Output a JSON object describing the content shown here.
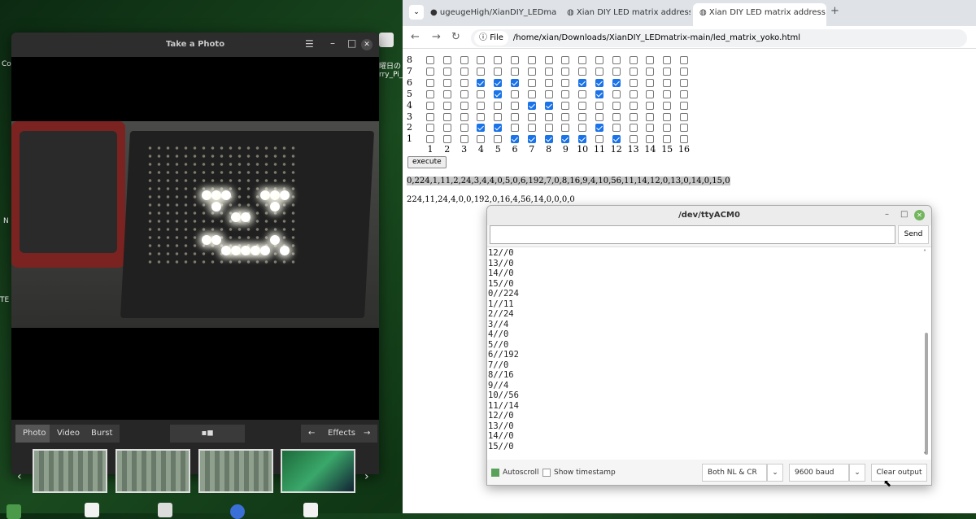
{
  "desktop": {
    "labels": [
      "Co",
      "N",
      "TE",
      "曜日の",
      "rry_Pi_"
    ]
  },
  "camera": {
    "title": "Take a Photo",
    "modes": [
      "Photo",
      "Video",
      "Burst"
    ],
    "effects_label": "Effects"
  },
  "browser": {
    "tabs": [
      {
        "title": "ugeugeHigh/XianDIY_LEDma"
      },
      {
        "title": "Xian DIY LED matrix address"
      },
      {
        "title": "Xian DIY LED matrix address"
      }
    ],
    "url_scheme": "File",
    "url": "/home/xian/Downloads/XianDIY_LEDmatrix-main/led_matrix_yoko.html"
  },
  "matrix": {
    "row_labels": [
      "8",
      "7",
      "6",
      "5",
      "4",
      "3",
      "2",
      "1"
    ],
    "col_labels": [
      "1",
      "2",
      "3",
      "4",
      "5",
      "6",
      "7",
      "8",
      "9",
      "10",
      "11",
      "12",
      "13",
      "14",
      "15",
      "16"
    ],
    "rows": [
      [
        0,
        0,
        0,
        0,
        0,
        0,
        0,
        0,
        0,
        0,
        0,
        0,
        0,
        0,
        0,
        0
      ],
      [
        0,
        0,
        0,
        0,
        0,
        0,
        0,
        0,
        0,
        0,
        0,
        0,
        0,
        0,
        0,
        0
      ],
      [
        0,
        0,
        0,
        1,
        1,
        1,
        0,
        0,
        0,
        1,
        1,
        1,
        0,
        0,
        0,
        0
      ],
      [
        0,
        0,
        0,
        0,
        1,
        0,
        0,
        0,
        0,
        0,
        1,
        0,
        0,
        0,
        0,
        0
      ],
      [
        0,
        0,
        0,
        0,
        0,
        0,
        1,
        1,
        0,
        0,
        0,
        0,
        0,
        0,
        0,
        0
      ],
      [
        0,
        0,
        0,
        0,
        0,
        0,
        0,
        0,
        0,
        0,
        0,
        0,
        0,
        0,
        0,
        0
      ],
      [
        0,
        0,
        0,
        1,
        1,
        0,
        0,
        0,
        0,
        0,
        1,
        0,
        0,
        0,
        0,
        0
      ],
      [
        0,
        0,
        0,
        0,
        0,
        1,
        1,
        1,
        1,
        1,
        0,
        1,
        0,
        0,
        0,
        0
      ]
    ],
    "execute_label": "execute",
    "output_selected": "0,224,1,11,2,24,3,4,4,0,5,0,6,192,7,0,8,16,9,4,10,56,11,14,12,0,13,0,14,0,15,0",
    "output_plain": "224,11,24,4,0,0,192,0,16,4,56,14,0,0,0,0"
  },
  "serial": {
    "title": "/dev/ttyACM0",
    "send_label": "Send",
    "input_value": "",
    "lines": [
      "12//0",
      "13//0",
      "14//0",
      "15//0",
      "0//224",
      "1//11",
      "2//24",
      "3//4",
      "4//0",
      "5//0",
      "6//192",
      "7//0",
      "8//16",
      "9//4",
      "10//56",
      "11//14",
      "12//0",
      "13//0",
      "14//0",
      "15//0"
    ],
    "autoscroll_label": "Autoscroll",
    "autoscroll_checked": true,
    "timestamp_label": "Show timestamp",
    "timestamp_checked": false,
    "line_ending": "Both NL & CR",
    "baud": "9600 baud",
    "clear_label": "Clear output"
  },
  "colors": {
    "checkbox_on": "#1a73e8",
    "autoscroll_on": "#5aa25a",
    "close_green": "#73b65f"
  }
}
